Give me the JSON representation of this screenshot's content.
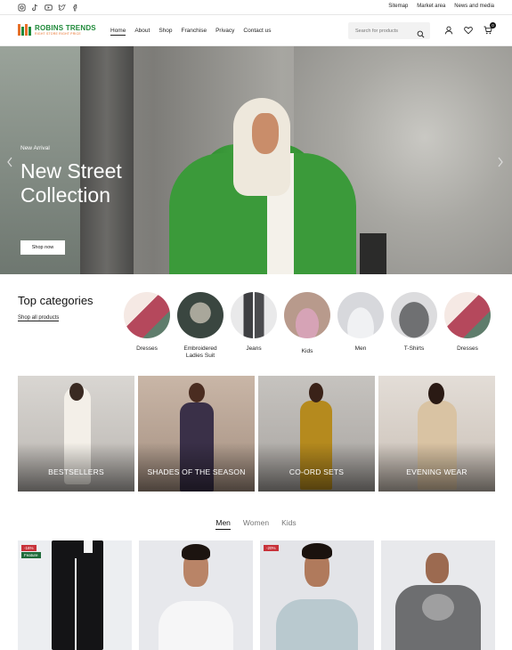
{
  "topbar": {
    "social": [
      {
        "icon": "instagram-icon"
      },
      {
        "icon": "tiktok-icon"
      },
      {
        "icon": "youtube-icon"
      },
      {
        "icon": "twitter-icon"
      },
      {
        "icon": "facebook-icon"
      }
    ],
    "links": [
      "Sitemap",
      "Market area",
      "News and media"
    ]
  },
  "header": {
    "logo": {
      "name": "ROBINS TRENDS",
      "tagline": "RIGHT STORE RIGHT PRICE"
    },
    "nav": [
      "Home",
      "About",
      "Shop",
      "Franchise",
      "Privacy",
      "Contact us"
    ],
    "active_nav": "Home",
    "search_placeholder": "Search for products",
    "cart_count": "0"
  },
  "hero": {
    "eyebrow": "New Arrival",
    "title": "New Street Collection",
    "button": "Shop now"
  },
  "categories": {
    "title": "Top categories",
    "link": "Shop all products",
    "items": [
      "Dresses",
      "Embroidered Ladies Suit",
      "Jeans",
      "Kids",
      "Men",
      "T-Shirts",
      "Dresses"
    ]
  },
  "collections": [
    "BESTSELLERS",
    "SHADES OF THE SEASON",
    "CO-ORD SETS",
    "EVENING WEAR"
  ],
  "product_tabs": {
    "items": [
      "Men",
      "Women",
      "Kids"
    ],
    "active": "Men"
  },
  "products": [
    {
      "badges": [
        "-16%",
        "Feature"
      ]
    },
    {
      "badges": []
    },
    {
      "badges": [
        "-20%"
      ]
    },
    {
      "badges": []
    }
  ],
  "colors": {
    "brand_green": "#1f8a3a",
    "brand_orange": "#e8702a",
    "sale_red": "#c8323a",
    "feature_green": "#1f6b3a"
  }
}
